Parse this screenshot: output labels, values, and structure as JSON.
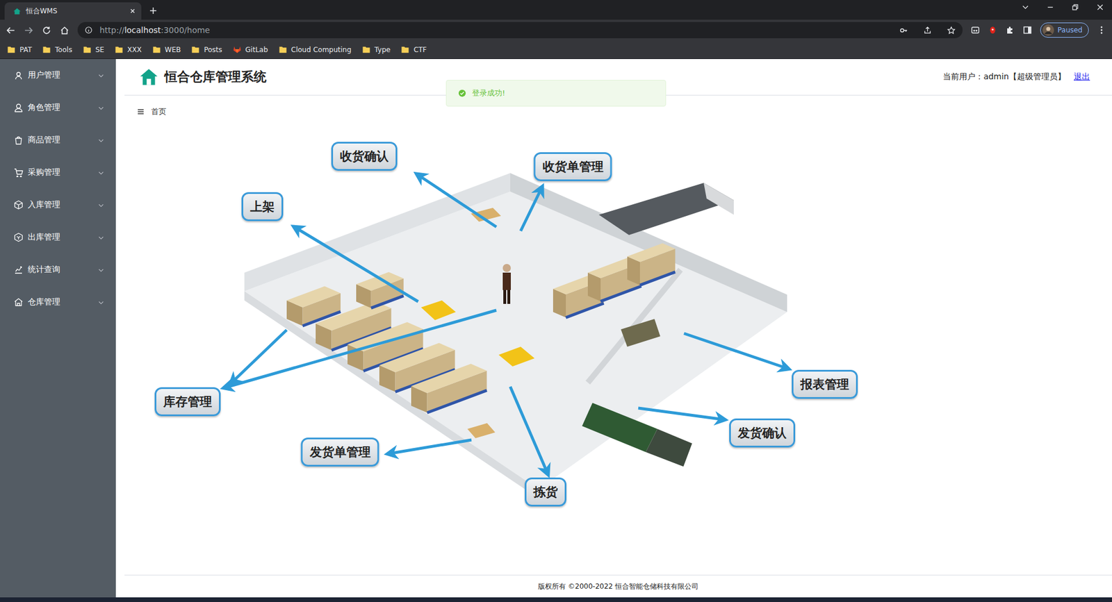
{
  "browser": {
    "tab_title": "恒合WMS",
    "url_prefix": "http://",
    "url_host": "localhost",
    "url_rest": ":3000/home",
    "profile": "Paused",
    "bookmarks": [
      {
        "label": "PAT",
        "kind": "folder"
      },
      {
        "label": "Tools",
        "kind": "folder"
      },
      {
        "label": "SE",
        "kind": "folder"
      },
      {
        "label": "XXX",
        "kind": "folder"
      },
      {
        "label": "WEB",
        "kind": "folder"
      },
      {
        "label": "Posts",
        "kind": "folder"
      },
      {
        "label": "GitLab",
        "kind": "gitlab"
      },
      {
        "label": "Cloud Computing",
        "kind": "folder"
      },
      {
        "label": "Type",
        "kind": "folder"
      },
      {
        "label": "CTF",
        "kind": "folder"
      }
    ]
  },
  "sidebar": {
    "items": [
      {
        "label": "用户管理",
        "expanded": false
      },
      {
        "label": "角色管理",
        "expanded": false
      },
      {
        "label": "商品管理",
        "expanded": false
      },
      {
        "label": "采购管理",
        "expanded": false
      },
      {
        "label": "入库管理",
        "expanded": false
      },
      {
        "label": "出库管理",
        "expanded": false
      },
      {
        "label": "统计查询",
        "expanded": false
      },
      {
        "label": "仓库管理",
        "expanded": false
      }
    ]
  },
  "header": {
    "title": "恒合仓库管理系统",
    "user_label": "当前用户：admin【超级管理员】",
    "logout": "退出"
  },
  "toast": {
    "message": "登录成功!",
    "kind": "success"
  },
  "breadcrumb": [
    "首页"
  ],
  "diagram": {
    "labels": [
      "收货确认",
      "收货单管理",
      "上架",
      "库存管理",
      "发货单管理",
      "拣货",
      "报表管理",
      "发货确认"
    ]
  },
  "footer": "版权所有 ©2000-2022  恒合智能仓储科技有限公司"
}
